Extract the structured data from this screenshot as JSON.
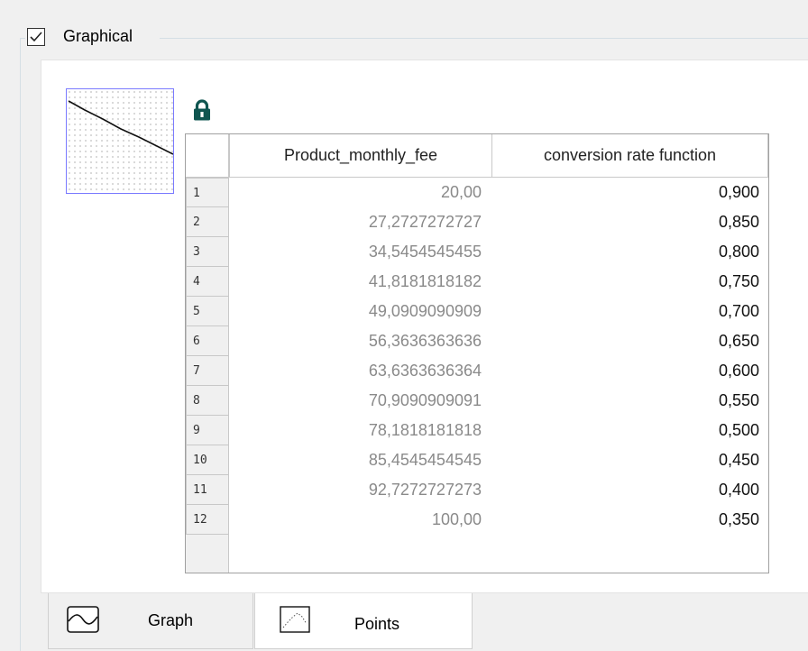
{
  "group": {
    "checkbox_label": "Graphical",
    "checked": true
  },
  "lock_icon": "padlock-locked",
  "table": {
    "columns": [
      "Product_monthly_fee",
      "conversion rate function"
    ],
    "rows": [
      {
        "index": "1",
        "x": "20,00",
        "y": "0,900"
      },
      {
        "index": "2",
        "x": "27,2727272727",
        "y": "0,850"
      },
      {
        "index": "3",
        "x": "34,5454545455",
        "y": "0,800"
      },
      {
        "index": "4",
        "x": "41,8181818182",
        "y": "0,750"
      },
      {
        "index": "5",
        "x": "49,0909090909",
        "y": "0,700"
      },
      {
        "index": "6",
        "x": "56,3636363636",
        "y": "0,650"
      },
      {
        "index": "7",
        "x": "63,6363636364",
        "y": "0,600"
      },
      {
        "index": "8",
        "x": "70,9090909091",
        "y": "0,550"
      },
      {
        "index": "9",
        "x": "78,1818181818",
        "y": "0,500"
      },
      {
        "index": "10",
        "x": "85,4545454545",
        "y": "0,450"
      },
      {
        "index": "11",
        "x": "92,7272727273",
        "y": "0,400"
      },
      {
        "index": "12",
        "x": "100,00",
        "y": "0,350"
      }
    ]
  },
  "tabs": [
    {
      "label": "Graph",
      "icon": "curve-graph-icon",
      "active": false
    },
    {
      "label": "Points",
      "icon": "scatter-points-icon",
      "active": true
    }
  ],
  "colors": {
    "thumbnail_border": "#7a7aff",
    "lock": "#0f5550"
  }
}
